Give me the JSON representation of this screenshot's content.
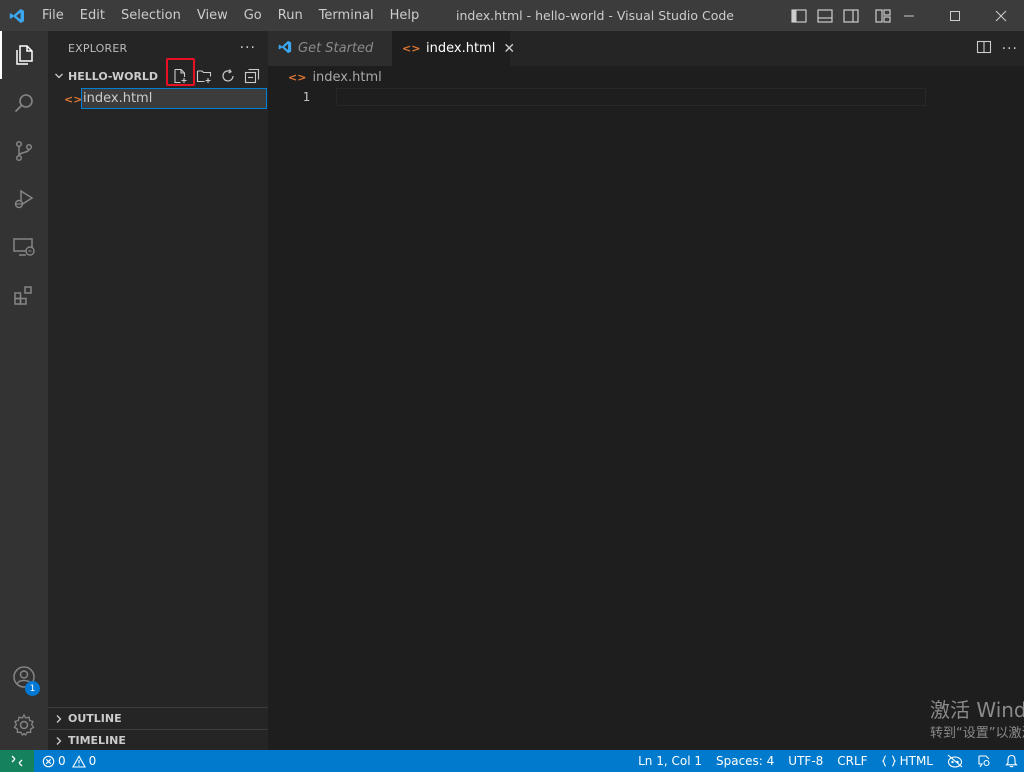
{
  "titlebar": {
    "menu": [
      "File",
      "Edit",
      "Selection",
      "View",
      "Go",
      "Run",
      "Terminal",
      "Help"
    ],
    "window_title": "index.html - hello-world - Visual Studio Code"
  },
  "activity_bar": {
    "items": [
      "explorer-icon",
      "search-icon",
      "source-control-icon",
      "run-debug-icon",
      "remote-explorer-icon",
      "extensions-icon"
    ],
    "accounts_badge": "1"
  },
  "sidebar": {
    "title": "EXPLORER",
    "more": "···",
    "folder_name": "HELLO-WORLD",
    "folder_actions": [
      "new-file-icon",
      "new-folder-icon",
      "refresh-icon",
      "collapse-all-icon"
    ],
    "rename_value": "index.html",
    "outline_label": "OUTLINE",
    "timeline_label": "TIMELINE"
  },
  "editor": {
    "tabs": [
      {
        "label": "Get Started",
        "active": false
      },
      {
        "label": "index.html",
        "active": true
      }
    ],
    "tab_close": "✕",
    "breadcrumb": "index.html",
    "line_numbers": [
      "1"
    ]
  },
  "watermark": {
    "line1": "激活 Windows",
    "line2": "转到“设置”以激活 Windows。"
  },
  "statusbar": {
    "errors": "0",
    "warnings": "0",
    "position": "Ln 1, Col 1",
    "spaces": "Spaces: 4",
    "encoding": "UTF-8",
    "eol": "CRLF",
    "language": "HTML"
  },
  "colors": {
    "accent": "#007acc",
    "highlight": "#e81123",
    "html_icon": "#e37933"
  }
}
